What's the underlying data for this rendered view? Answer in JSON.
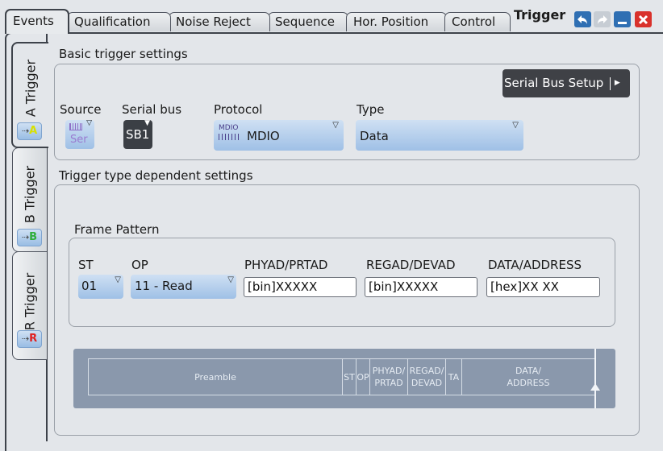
{
  "tabs": {
    "events": "Events",
    "qualification": "Qualification",
    "noise_reject": "Noise Reject",
    "sequence": "Sequence",
    "hor_position": "Hor. Position",
    "control": "Control"
  },
  "dialog_title": "Trigger",
  "side_tabs": {
    "a": {
      "label": "A Trigger",
      "icon_letter": "A",
      "icon_color": "#d8e000"
    },
    "b": {
      "label": "B Trigger",
      "icon_letter": "B",
      "icon_color": "#2fae3a"
    },
    "r": {
      "label": "R Trigger",
      "icon_letter": "R",
      "icon_color": "#e02020"
    }
  },
  "basic": {
    "title": "Basic trigger settings",
    "serial_bus_setup": "Serial Bus Setup",
    "source_label": "Source",
    "source_value": "Ser",
    "serial_bus_label": "Serial bus",
    "serial_bus_value": "SB1",
    "protocol_label": "Protocol",
    "protocol_icon": "MDIO",
    "protocol_value": "MDIO",
    "type_label": "Type",
    "type_value": "Data"
  },
  "dependent": {
    "title": "Trigger type dependent settings",
    "frame_pattern_title": "Frame Pattern",
    "st_label": "ST",
    "st_value": "01",
    "op_label": "OP",
    "op_value": "11 - Read",
    "phyad_label": "PHYAD/PRTAD",
    "phyad_value": "[bin]XXXXX",
    "regad_label": "REGAD/DEVAD",
    "regad_value": "[bin]XXXXX",
    "data_label": "DATA/ADDRESS",
    "data_value": "[hex]XX XX"
  },
  "diagram": {
    "preamble": "Preamble",
    "st": "ST",
    "op": "OP",
    "phyad_1": "PHYAD/",
    "phyad_2": "PRTAD",
    "regad_1": "REGAD/",
    "regad_2": "DEVAD",
    "ta": "TA",
    "data_1": "DATA/",
    "data_2": "ADDRESS"
  },
  "colors": {
    "accent_blue": "#9fc0e6",
    "close_red": "#d9312b",
    "window_buttons": "#2f6fb3",
    "diagram_bg": "#8a98ac"
  },
  "icons": [
    "undo-icon",
    "redo-icon",
    "minimize-icon",
    "close-icon",
    "arrow-right-icon"
  ]
}
